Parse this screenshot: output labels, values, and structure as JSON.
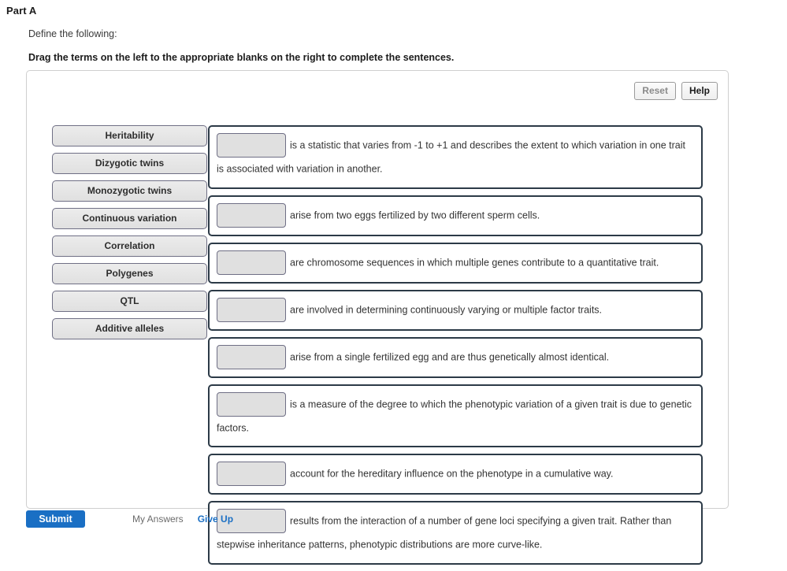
{
  "header": {
    "part_title": "Part A",
    "define_prompt": "Define the following:",
    "drag_instruction": "Drag the terms on the left to the appropriate blanks on the right to complete the sentences."
  },
  "toolbar": {
    "reset_label": "Reset",
    "help_label": "Help"
  },
  "terms": [
    {
      "label": "Heritability"
    },
    {
      "label": "Dizygotic twins"
    },
    {
      "label": "Monozygotic twins"
    },
    {
      "label": "Continuous variation"
    },
    {
      "label": "Correlation"
    },
    {
      "label": "Polygenes"
    },
    {
      "label": "QTL"
    },
    {
      "label": "Additive alleles"
    }
  ],
  "sentences": [
    {
      "blank_value": "",
      "text": "is a statistic that varies from -1 to +1 and describes the extent to which variation in one trait is associated with variation in another."
    },
    {
      "blank_value": "",
      "text": "arise from two eggs fertilized by two different sperm cells."
    },
    {
      "blank_value": "",
      "text": "are chromosome sequences in which multiple genes contribute to a quantitative trait."
    },
    {
      "blank_value": "",
      "text": "are involved in determining continuously varying or multiple factor traits."
    },
    {
      "blank_value": "",
      "text": "arise from a single fertilized egg and are thus genetically almost identical."
    },
    {
      "blank_value": "",
      "text": "is a measure of the degree to which the phenotypic variation of a given trait is due to genetic factors."
    },
    {
      "blank_value": "",
      "text": "account for the hereditary influence on the phenotype in a cumulative way."
    },
    {
      "blank_value": "",
      "text": "results from the interaction of a number of gene loci specifying a given trait. Rather than stepwise inheritance patterns, phenotypic distributions are more curve-like."
    }
  ],
  "actions": {
    "submit_label": "Submit",
    "my_answers_label": "My Answers",
    "give_up_label": "Give Up"
  },
  "colors": {
    "accent_blue": "#1a6fc4",
    "chip_border": "#6f6f85",
    "sentence_border": "#2c3a47",
    "panel_border": "#cfcfcf",
    "blank_fill": "#e0e0e0"
  }
}
